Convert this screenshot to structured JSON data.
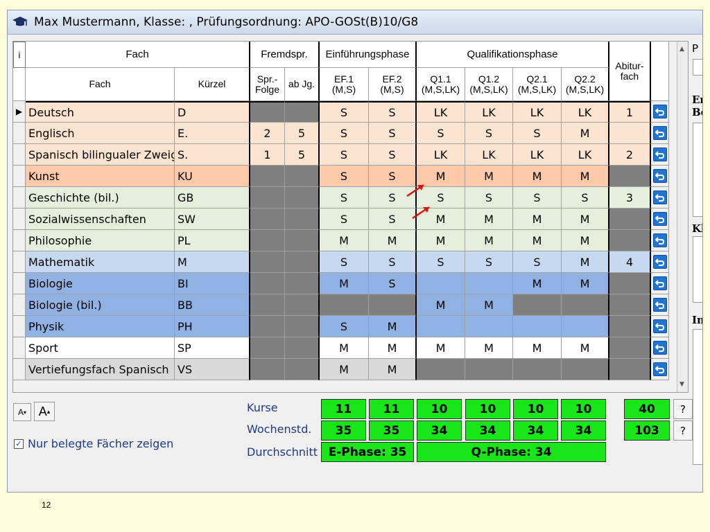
{
  "window": {
    "title": "Max Mustermann, Klasse: , Prüfungsordnung: APO-GOSt(B)10/G8",
    "icon": "graduation-cap-icon"
  },
  "grid": {
    "info_button": "i",
    "header_groups": {
      "fach": "Fach",
      "fremdspr": "Fremdspr.",
      "einfuehrung": "Einführungsphase",
      "qualifikation": "Qualifikationsphase",
      "abitur": "Abitur-\nfach"
    },
    "columns": [
      "Fach",
      "Kürzel",
      "Spr.-\nFolge",
      "ab Jg.",
      "EF.1\n(M,S)",
      "EF.2\n(M,S)",
      "Q1.1\n(M,S,LK)",
      "Q1.2\n(M,S,LK)",
      "Q2.1\n(M,S,LK)",
      "Q2.2\n(M,S,LK)"
    ],
    "rows": [
      {
        "fach": "Deutsch",
        "kuerzel": "D",
        "spr": "",
        "abjg": "",
        "ef1": "S",
        "ef2": "S",
        "q11": "LK",
        "q12": "LK",
        "q21": "LK",
        "q22": "LK",
        "abi": "1",
        "bg": "#fde4d0"
      },
      {
        "fach": "Englisch",
        "kuerzel": "E.",
        "spr": "2",
        "abjg": "5",
        "ef1": "S",
        "ef2": "S",
        "q11": "S",
        "q12": "S",
        "q21": "S",
        "q22": "M",
        "abi": "",
        "bg": "#fde4d0"
      },
      {
        "fach": "Spanisch bilingualer Zweig",
        "kuerzel": "S.",
        "spr": "1",
        "abjg": "5",
        "ef1": "S",
        "ef2": "S",
        "q11": "LK",
        "q12": "LK",
        "q21": "LK",
        "q22": "LK",
        "abi": "2",
        "bg": "#fde4d0"
      },
      {
        "fach": "Kunst",
        "kuerzel": "KU",
        "spr": "",
        "abjg": "",
        "ef1": "S",
        "ef2": "S",
        "q11": "M",
        "q12": "M",
        "q21": "M",
        "q22": "M",
        "abi": "",
        "bg": "#fdc9a8"
      },
      {
        "fach": "Geschichte (bil.)",
        "kuerzel": "GB",
        "spr": "",
        "abjg": "",
        "ef1": "S",
        "ef2": "S",
        "q11": "S",
        "q12": "S",
        "q21": "S",
        "q22": "S",
        "abi": "3",
        "bg": "#e6efdc"
      },
      {
        "fach": "Sozialwissenschaften",
        "kuerzel": "SW",
        "spr": "",
        "abjg": "",
        "ef1": "S",
        "ef2": "S",
        "q11": "M",
        "q12": "M",
        "q21": "M",
        "q22": "M",
        "abi": "",
        "bg": "#e6efdc"
      },
      {
        "fach": "Philosophie",
        "kuerzel": "PL",
        "spr": "",
        "abjg": "",
        "ef1": "M",
        "ef2": "M",
        "q11": "M",
        "q12": "M",
        "q21": "M",
        "q22": "M",
        "abi": "",
        "bg": "#e6efdc"
      },
      {
        "fach": "Mathematik",
        "kuerzel": "M",
        "spr": "",
        "abjg": "",
        "ef1": "S",
        "ef2": "S",
        "q11": "S",
        "q12": "S",
        "q21": "S",
        "q22": "M",
        "abi": "4",
        "bg": "#c7d9f1"
      },
      {
        "fach": "Biologie",
        "kuerzel": "BI",
        "spr": "",
        "abjg": "",
        "ef1": "M",
        "ef2": "S",
        "q11": "",
        "q12": "",
        "q21": "M",
        "q22": "M",
        "abi": "",
        "bg": "#8fb1e3"
      },
      {
        "fach": "Biologie (bil.)",
        "kuerzel": "BB",
        "spr": "",
        "abjg": "",
        "ef1": "",
        "ef2": "",
        "q11": "M",
        "q12": "M",
        "q21": "",
        "q22": "",
        "abi": "",
        "bg": "#8fb1e3"
      },
      {
        "fach": "Physik",
        "kuerzel": "PH",
        "spr": "",
        "abjg": "",
        "ef1": "S",
        "ef2": "M",
        "q11": "",
        "q12": "",
        "q21": "",
        "q22": "",
        "abi": "",
        "bg": "#8fb1e3"
      },
      {
        "fach": "Sport",
        "kuerzel": "SP",
        "spr": "",
        "abjg": "",
        "ef1": "M",
        "ef2": "M",
        "q11": "M",
        "q12": "M",
        "q21": "M",
        "q22": "M",
        "abi": "",
        "bg": "#ffffff"
      },
      {
        "fach": "Vertiefungsfach Spanisch",
        "kuerzel": "VS",
        "spr": "",
        "abjg": "",
        "ef1": "M",
        "ef2": "M",
        "q11": "",
        "q12": "",
        "q21": "",
        "q22": "",
        "abi": "",
        "bg": "#d9d9d9"
      }
    ]
  },
  "summary": {
    "kurse_label": "Kurse",
    "wochenstd_label": "Wochenstd.",
    "durchschnitt_label": "Durchschnitt",
    "kurse": [
      "11",
      "11",
      "10",
      "10",
      "10",
      "10"
    ],
    "kurse_total": "40",
    "wochenstd": [
      "35",
      "35",
      "34",
      "34",
      "34",
      "34"
    ],
    "wochenstd_total": "103",
    "ephase": "E-Phase: 35",
    "qphase": "Q-Phase: 34",
    "help_label": "?"
  },
  "controls": {
    "font_smaller": "A",
    "font_larger": "A",
    "checkbox_label": "Nur belegte Fächer zeigen",
    "checkbox_checked": true
  },
  "right_panel": {
    "labels": [
      "P",
      "Er",
      "Be",
      "Kl",
      "In"
    ]
  },
  "footer": {
    "page_number": "12"
  },
  "colors": {
    "green_sum": "#19e619",
    "gray_disabled": "#7f7f7f",
    "arrow_red": "#e01010",
    "button_blue": "#1f74d6"
  }
}
